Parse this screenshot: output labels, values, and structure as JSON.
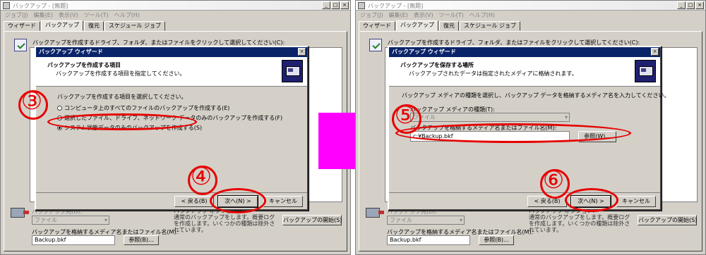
{
  "window_title": "バックアップ - [無題]",
  "menu": [
    "ジョブ(J)",
    "編集(E)",
    "表示(V)",
    "ツール(T)",
    "ヘルプ(H)"
  ],
  "window_controls": [
    "_",
    "□",
    "×"
  ],
  "tabs": [
    "ウィザード",
    "バックアップ",
    "復元",
    "スケジュール ジョブ"
  ],
  "panel_instruction": "バックアップを作成するドライブ、フォルダ、またはファイルをクリックして選択してください(C):",
  "bottom": {
    "dest_label": "バックアップ先(D):",
    "dest_value": "ファイル",
    "info_text": "バックアップ オプション:\n通常のバックアップをします。概要ログを作成します。いくつかの種類は除外されています。",
    "start_button": "バックアップの開始(S)",
    "name_label": "バックアップを格納するメディア名またはファイル名(M):",
    "name_value": "Backup.bkf",
    "browse_button": "参照(B)..."
  },
  "wizard": {
    "title": "バックアップ ウィザード",
    "close": "×",
    "back_button": "< 戻る(B)",
    "next_button": "次へ(N) >",
    "cancel_button": "キャンセル"
  },
  "left": {
    "header_title": "バックアップを作成する項目",
    "header_sub": "バックアップを作成する項目を指定してください。",
    "prompt": "バックアップを作成する項目を選択してください。",
    "options": [
      "コンピュータ上のすべてのファイルのバックアップを作成する(E)",
      "選択したファイル、ドライブ、ネットワーク データのみのバックアップを作成する(F)",
      "システム状態データのみのバックアップを作成する(S)"
    ],
    "selected_option": 2,
    "step_main": "③",
    "step_next": "④"
  },
  "right": {
    "header_title": "バックアップを保存する場所",
    "header_sub": "バックアップされたデータは指定されたメディアに格納されます。",
    "prompt": "バックアップ メディアの種類を選択し、バックアップ データを格納するメディア名を入力してください。",
    "media_type_label": "バックアップ メディアの種類(T):",
    "media_type_value": "ファイル",
    "media_name_label": "バックアップを格納するメディア名またはファイル名(M):",
    "media_name_value": "c:¥Backup.bkf",
    "browse_button": "参照(W)...",
    "step_main": "⑤",
    "step_next": "⑥"
  },
  "colors": {
    "annotation_red": "#e60000",
    "arrow_magenta": "#ff00ff",
    "wizard_titlebar": "#0a246a"
  }
}
